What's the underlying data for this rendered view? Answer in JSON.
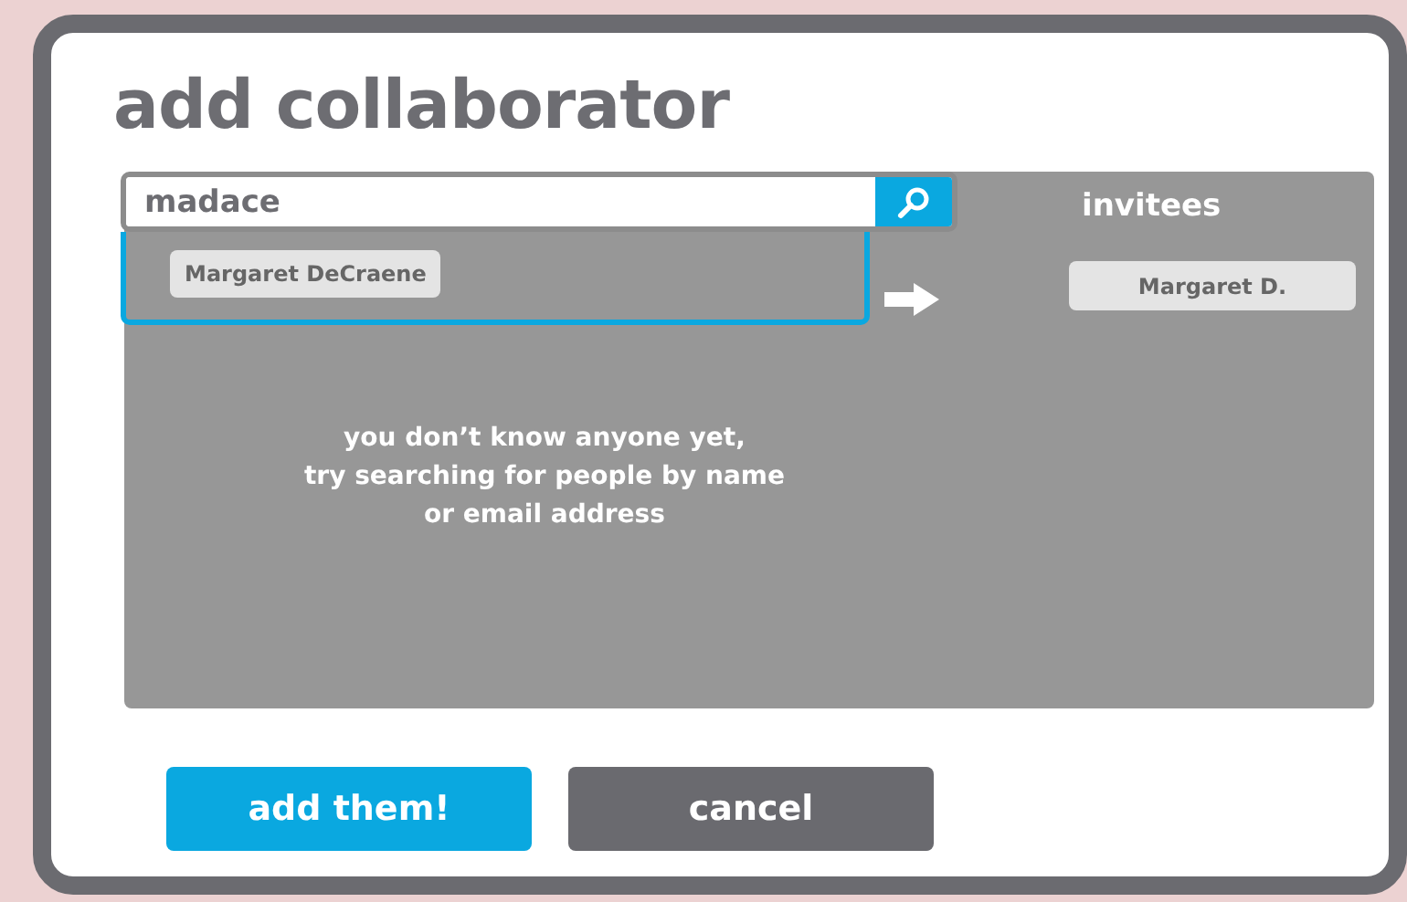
{
  "title": "add collaborator",
  "search": {
    "value": "madace"
  },
  "suggestions": [
    {
      "name": "Margaret DeCraene"
    }
  ],
  "invitees": {
    "title": "invitees",
    "people": [
      {
        "name": "Margaret D."
      }
    ]
  },
  "empty_message": "you don’t know anyone yet,\ntry searching for people by name\nor email address",
  "buttons": [
    {
      "label": "add them!",
      "kind": "primary"
    },
    {
      "label": "cancel",
      "kind": "secondary"
    }
  ]
}
